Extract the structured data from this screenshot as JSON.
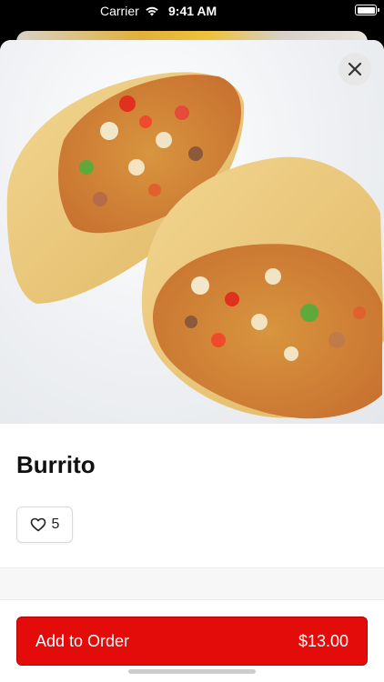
{
  "status_bar": {
    "carrier": "Carrier",
    "time": "9:41 AM"
  },
  "item": {
    "title": "Burrito",
    "likes": "5",
    "image_icon": "burrito-photo"
  },
  "actions": {
    "add_label": "Add to Order",
    "price": "$13.00",
    "close_icon": "close-icon",
    "like_icon": "heart-icon"
  },
  "colors": {
    "accent": "#e40b0b",
    "sheet_bg": "#ffffff",
    "status_bg": "#000000"
  }
}
